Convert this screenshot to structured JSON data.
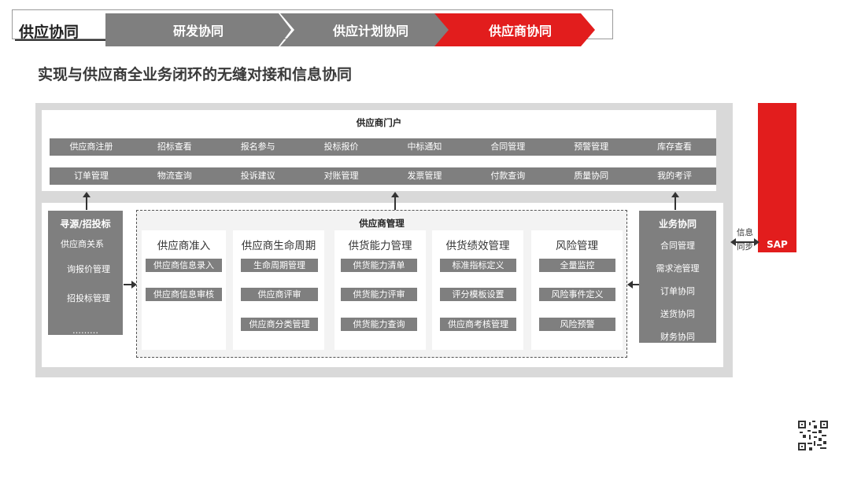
{
  "header": {
    "title": "供应协同",
    "tabs": [
      "研发协同",
      "供应计划协同",
      "供应商协同"
    ],
    "active_tab_color": "#e21d1d",
    "inactive_tab_color": "#7f7f7f"
  },
  "subtitle": "实现与供应商全业务闭环的无缝对接和信息协同",
  "portal": {
    "title": "供应商门户",
    "row1": [
      "供应商注册",
      "招标查看",
      "报名参与",
      "投标报价",
      "中标通知",
      "合同管理",
      "预警管理",
      "库存查看"
    ],
    "row2": [
      "订单管理",
      "物流查询",
      "投诉建议",
      "对账管理",
      "发票管理",
      "付款查询",
      "质量协同",
      "我的考评"
    ]
  },
  "sourcing": {
    "title": "寻源/招投标",
    "items": [
      "供应商关系",
      "询报价管理",
      "招投标管理",
      "………"
    ]
  },
  "management": {
    "title": "供应商管理",
    "columns": [
      {
        "title": "供应商准入",
        "items": [
          "供应商信息录入",
          "供应商信息审核"
        ]
      },
      {
        "title": "供应商生命周期",
        "items": [
          "生命周期管理",
          "供应商评审",
          "供应商分类管理"
        ]
      },
      {
        "title": "供货能力管理",
        "items": [
          "供货能力清单",
          "供货能力评审",
          "供货能力查询"
        ]
      },
      {
        "title": "供货绩效管理",
        "items": [
          "标准指标定义",
          "评分模板设置",
          "供应商考核管理"
        ]
      },
      {
        "title": "风险管理",
        "items": [
          "全量监控",
          "风险事件定义",
          "风险预警"
        ]
      }
    ]
  },
  "business": {
    "title": "业务协同",
    "items": [
      "合同管理",
      "需求池管理",
      "订单协同",
      "送货协同",
      "财务协同"
    ]
  },
  "sap": {
    "label": "SAP",
    "sync_line1": "信息",
    "sync_line2": "同步"
  }
}
